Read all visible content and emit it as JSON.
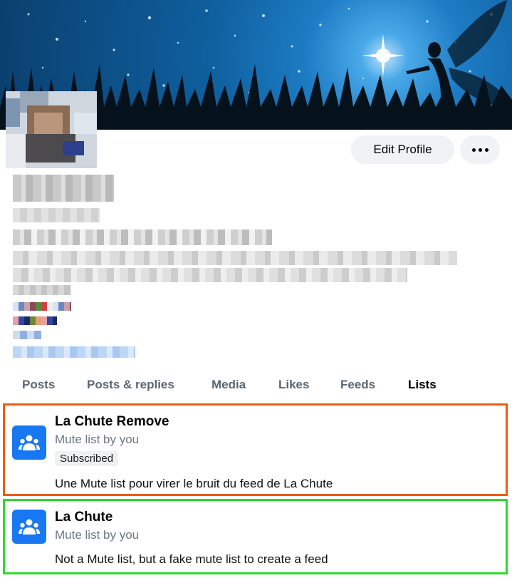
{
  "profile": {
    "edit_label": "Edit Profile",
    "more_icon": "more-horizontal-icon"
  },
  "tabs": [
    {
      "label": "Posts",
      "active": false
    },
    {
      "label": "Posts & replies",
      "active": false
    },
    {
      "label": "Media",
      "active": false
    },
    {
      "label": "Likes",
      "active": false
    },
    {
      "label": "Feeds",
      "active": false
    },
    {
      "label": "Lists",
      "active": true
    }
  ],
  "lists": [
    {
      "title": "La Chute Remove",
      "subtitle": "Mute list by you",
      "badge": "Subscribed",
      "description": "Une Mute list pour virer le bruit du feed de La Chute",
      "icon": "group-icon",
      "highlight_color": "#f05a14"
    },
    {
      "title": "La Chute",
      "subtitle": "Mute list by you",
      "description": "Not a Mute list, but a fake mute list to create a feed",
      "icon": "group-icon",
      "highlight_color": "#2fd82f"
    }
  ],
  "colors": {
    "accent": "#1877f2",
    "tab_inactive": "#5b6672"
  }
}
